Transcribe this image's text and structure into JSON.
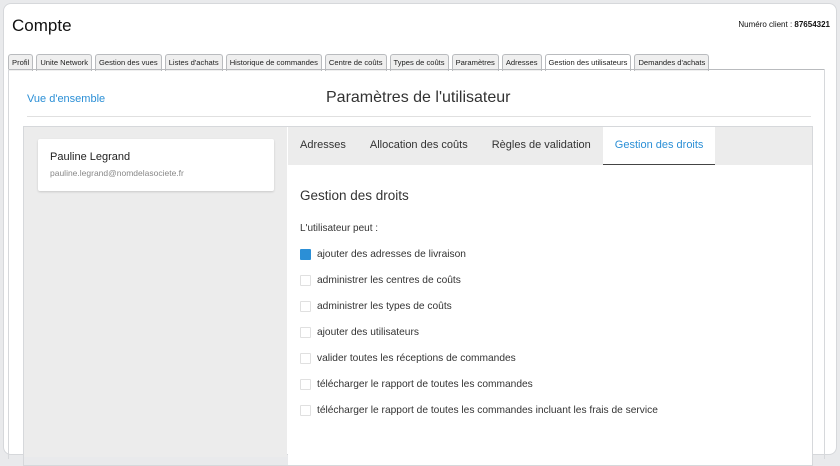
{
  "header": {
    "title": "Compte",
    "client_label": "Numéro client :",
    "client_number": "87654321"
  },
  "tabs": [
    {
      "label": "Profil",
      "active": false
    },
    {
      "label": "Unite Network",
      "active": false
    },
    {
      "label": "Gestion des vues",
      "active": false
    },
    {
      "label": "Listes d'achats",
      "active": false
    },
    {
      "label": "Historique de commandes",
      "active": false
    },
    {
      "label": "Centre de coûts",
      "active": false
    },
    {
      "label": "Types de coûts",
      "active": false
    },
    {
      "label": "Paramètres",
      "active": false
    },
    {
      "label": "Adresses",
      "active": false
    },
    {
      "label": "Gestion des utilisateurs",
      "active": true
    },
    {
      "label": "Demandes d'achats",
      "active": false
    }
  ],
  "page": {
    "overview_link": "Vue d'ensemble",
    "title": "Paramètres de l'utilisateur"
  },
  "user": {
    "name": "Pauline Legrand",
    "email": "pauline.legrand@nomdelasociete.fr"
  },
  "subtabs": [
    {
      "label": "Adresses",
      "active": false
    },
    {
      "label": "Allocation des coûts",
      "active": false
    },
    {
      "label": "Règles de validation",
      "active": false
    },
    {
      "label": "Gestion des droits",
      "active": true
    }
  ],
  "rights": {
    "title": "Gestion des droits",
    "can_label": "L'utilisateur peut :",
    "permissions": [
      {
        "label": "ajouter des adresses de livraison",
        "checked": true
      },
      {
        "label": "administrer les centres de coûts",
        "checked": false
      },
      {
        "label": "administrer les types de coûts",
        "checked": false
      },
      {
        "label": "ajouter des utilisateurs",
        "checked": false
      },
      {
        "label": "valider toutes les réceptions de commandes",
        "checked": false
      },
      {
        "label": "télécharger le rapport de toutes les commandes",
        "checked": false
      },
      {
        "label": "télécharger le rapport de toutes les commandes incluant les frais de service",
        "checked": false
      }
    ]
  },
  "colors": {
    "accent": "#2b8fd6",
    "panel_bg": "#ececec"
  }
}
